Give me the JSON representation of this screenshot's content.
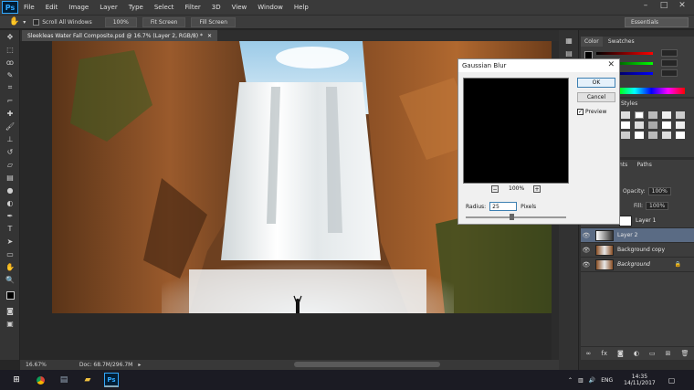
{
  "app": {
    "logo": "Ps"
  },
  "menu": [
    "File",
    "Edit",
    "Image",
    "Layer",
    "Type",
    "Select",
    "Filter",
    "3D",
    "View",
    "Window",
    "Help"
  ],
  "window_controls": [
    "–",
    "□",
    "✕"
  ],
  "options": {
    "scroll_all_label": "Scroll All Windows",
    "zoom_btn": "100%",
    "fit_btn": "Fit Screen",
    "fill_btn": "Fill Screen",
    "workspace": "Essentials"
  },
  "document": {
    "tab_title": "Sleekleas Water Fall Composite.psd @ 16.7% (Layer 2, RGB/8) *",
    "zoom": "16.67%",
    "doc_size": "Doc: 68.7M/296.7M"
  },
  "panels": {
    "color_tab": "Color",
    "swatches_tab": "Swatches",
    "styles_tab": "Styles",
    "paths_tab": "Paths",
    "channels_tab": "nts",
    "opacity_label": "Opacity:",
    "fill_label": "Fill:",
    "opacity_value": "100%",
    "fill_value": "100%"
  },
  "layers": [
    {
      "name": "Layer 1",
      "visible": false,
      "selected": false
    },
    {
      "name": "Layer 2",
      "visible": true,
      "selected": true
    },
    {
      "name": "Background copy",
      "visible": true,
      "selected": false
    },
    {
      "name": "Background",
      "visible": true,
      "selected": false
    }
  ],
  "dialog": {
    "title": "Gaussian Blur",
    "ok": "OK",
    "cancel": "Cancel",
    "preview_label": "Preview",
    "preview_checked": true,
    "zoom": "100%",
    "radius_label": "Radius:",
    "radius_value": "25",
    "radius_unit": "Pixels"
  },
  "taskbar": {
    "lang": "ENG",
    "time": "14:35",
    "date": "14/11/2017"
  },
  "colors": {
    "accent": "#31a8ff",
    "selected_layer": "#5a6b84"
  }
}
